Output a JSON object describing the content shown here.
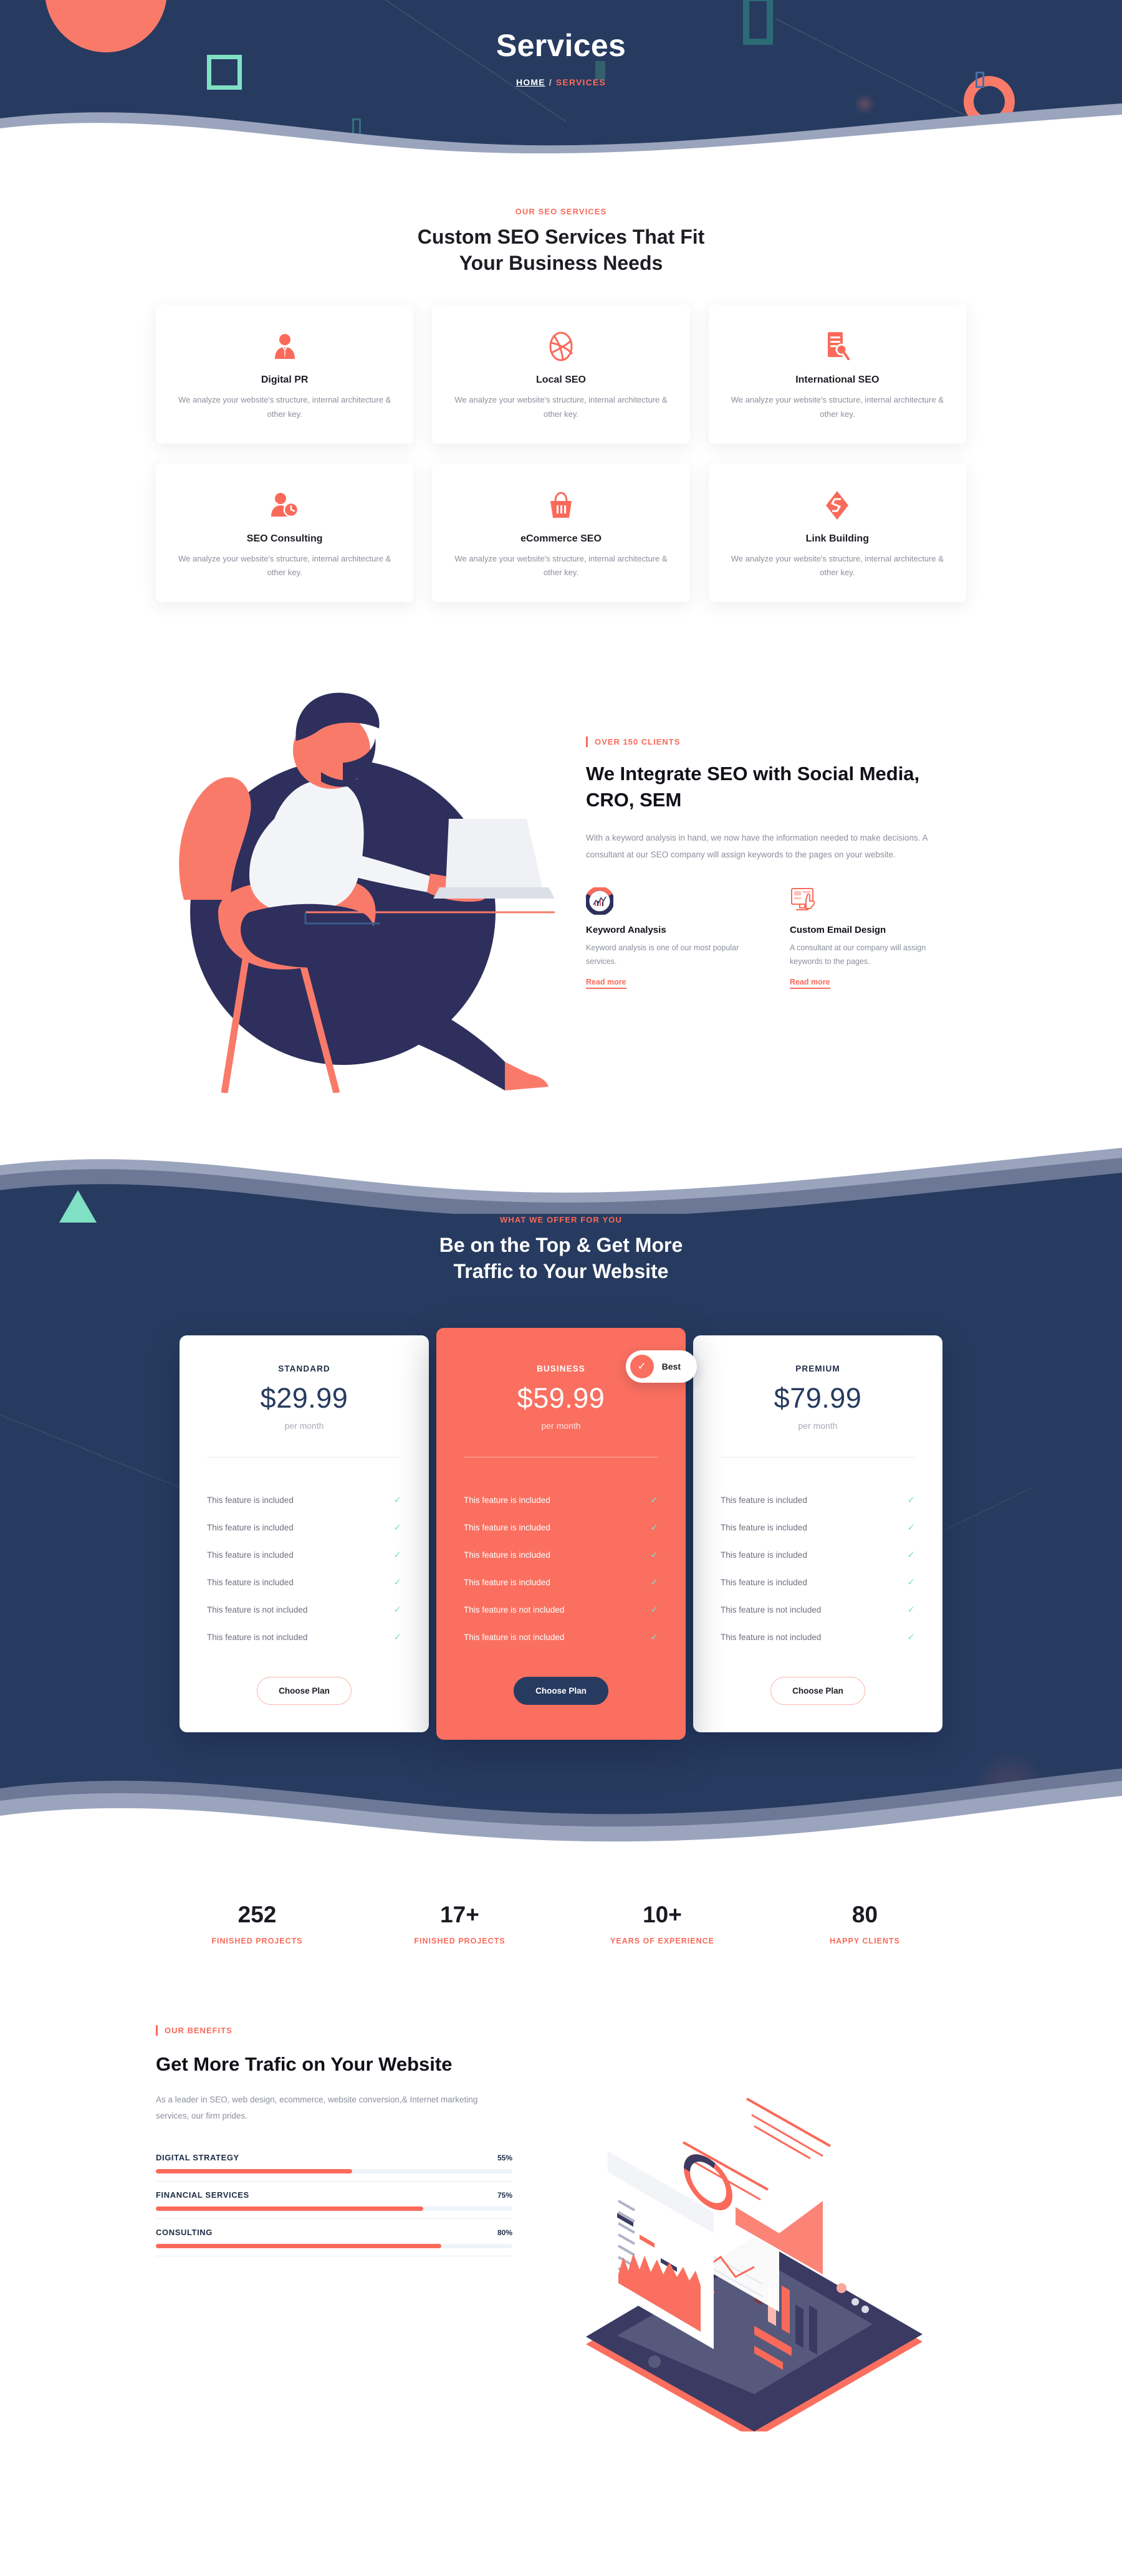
{
  "hero": {
    "title": "Services",
    "breadcrumb_home": "HOME",
    "breadcrumb_sep": "/",
    "breadcrumb_current": "SERVICES"
  },
  "services_section": {
    "eyebrow": "OUR SEO SERVICES",
    "title_line1": "Custom SEO Services That Fit",
    "title_line2": "Your Business Needs",
    "cards": [
      {
        "icon": "user-tie-icon",
        "name": "Digital PR",
        "desc": "We analyze your website's structure, internal architecture & other key."
      },
      {
        "icon": "dribbble-ball-icon",
        "name": "Local SEO",
        "desc": "We analyze your website's structure, internal architecture & other key."
      },
      {
        "icon": "document-search-icon",
        "name": "International SEO",
        "desc": "We analyze your website's structure, internal architecture & other key."
      },
      {
        "icon": "user-clock-icon",
        "name": "SEO Consulting",
        "desc": "We analyze your website's structure, internal architecture & other key."
      },
      {
        "icon": "basket-icon",
        "name": "eCommerce SEO",
        "desc": "We analyze your website's structure, internal architecture & other key."
      },
      {
        "icon": "link-diamond-icon",
        "name": "Link Building",
        "desc": "We analyze your website's structure, internal architecture & other key."
      }
    ]
  },
  "integrate": {
    "tag": "OVER 150 CLIENTS",
    "title": "We Integrate SEO with Social Media, CRO, SEM",
    "paragraph": "With a keyword analysis in hand, we now have the information needed to make decisions. A consultant at our SEO company will assign keywords to the pages on your website.",
    "features": [
      {
        "icon": "donut-chart-icon",
        "title": "Keyword Analysis",
        "desc": "Keyword analysis is one of our most popular services.",
        "link": "Read more"
      },
      {
        "icon": "monitor-hand-icon",
        "title": "Custom Email Design",
        "desc": "A consultant at our company will assign keywords to the pages.",
        "link": "Read more"
      }
    ]
  },
  "pricing": {
    "eyebrow": "WHAT WE OFFER FOR YOU",
    "title_line1": "Be on the Top & Get More",
    "title_line2": "Traffic to Your Website",
    "badge_label": "Best",
    "badge_icon": "check-icon",
    "plans": [
      {
        "name": "STANDARD",
        "price": "$29.99",
        "period": "per month",
        "featured": false,
        "cta": "Choose Plan",
        "features": [
          "This feature is included",
          "This feature is included",
          "This feature is included",
          "This feature is included",
          "This feature is not included",
          "This feature is not included"
        ]
      },
      {
        "name": "BUSINESS",
        "price": "$59.99",
        "period": "per month",
        "featured": true,
        "cta": "Choose Plan",
        "features": [
          "This feature is included",
          "This feature is included",
          "This feature is included",
          "This feature is included",
          "This feature is not included",
          "This feature is not included"
        ]
      },
      {
        "name": "PREMIUM",
        "price": "$79.99",
        "period": "per month",
        "featured": false,
        "cta": "Choose Plan",
        "features": [
          "This feature is included",
          "This feature is included",
          "This feature is included",
          "This feature is included",
          "This feature is not included",
          "This feature is not included"
        ]
      }
    ]
  },
  "stats": [
    {
      "value": "252",
      "label": "FINISHED PROJECTS"
    },
    {
      "value": "17+",
      "label": "FINISHED PROJECTS"
    },
    {
      "value": "10+",
      "label": "YEARS OF EXPERIENCE"
    },
    {
      "value": "80",
      "label": "HAPPY CLIENTS"
    }
  ],
  "benefits": {
    "tag": "OUR BENEFITS",
    "title": "Get More Trafic on Your Website",
    "paragraph": "As a leader in SEO, web design, ecommerce, website conversion,& Internet marketing services, our firm prides.",
    "bars": [
      {
        "name": "DIGITAL STRATEGY",
        "pct": "55%",
        "value": 55
      },
      {
        "name": "FINANCIAL SERVICES",
        "pct": "75%",
        "value": 75
      },
      {
        "name": "CONSULTING",
        "pct": "80%",
        "value": 80
      }
    ]
  },
  "colors": {
    "accent": "#fa6a5a",
    "dark": "#273b60",
    "mint": "#7fe0c4",
    "teal": "#2c6a75",
    "text": "#1d1d24",
    "muted": "#8b8f9c"
  },
  "chart_data": {
    "type": "bar",
    "title": "Get More Trafic on Your Website",
    "categories": [
      "DIGITAL STRATEGY",
      "FINANCIAL SERVICES",
      "CONSULTING"
    ],
    "values": [
      55,
      75,
      80
    ],
    "xlabel": "",
    "ylabel": "",
    "ylim": [
      0,
      100
    ],
    "orientation": "horizontal",
    "grid": false,
    "legend": "none",
    "bar_color": "#fa6a5a",
    "track_color": "#eef4fa"
  }
}
